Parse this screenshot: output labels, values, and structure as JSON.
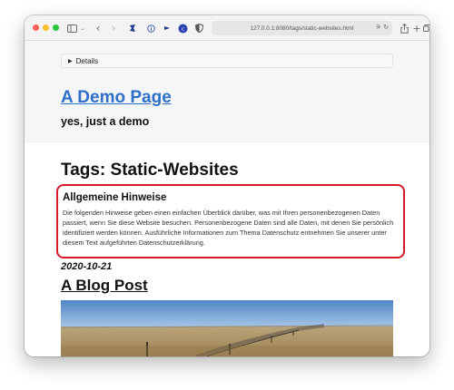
{
  "browser": {
    "url": "127.0.0.1:8080/tags/static-websites.html",
    "colors": {
      "close": "#ff5f57",
      "minimize": "#febc2e",
      "maximize": "#28c840"
    },
    "icons": [
      "sidebar-icon",
      "chevron-down-icon",
      "back-icon",
      "forward-icon",
      "extension-icon",
      "info-icon",
      "arrow-icon",
      "extension-badge-icon",
      "shield-icon",
      "translate-icon",
      "reload-icon",
      "share-icon",
      "new-tab-icon",
      "tab-overview-icon"
    ]
  },
  "header": {
    "details_label": "Details",
    "site_title": "A Demo Page",
    "site_subtitle": "yes, just a demo"
  },
  "main": {
    "tag_heading": "Tags: Static-Websites",
    "notice": {
      "title": "Allgemeine Hinweise",
      "body": "Die folgenden Hinweise geben einen einfachen Überblick darüber, was mit Ihren personenbezogenen Daten passiert, wenn Sie diese Website besuchen. Personenbezogene Daten sind alle Daten, mit denen Sie persönlich identifiziert werden können. Ausführliche Informationen zum Thema Datenschutz entnehmen Sie unserer unter diesem Text aufgeführten Datenschutzerklärung."
    },
    "post": {
      "date": "2020-10-21",
      "title": "A Blog Post"
    },
    "accent_color": "#d7192a",
    "link_color": "#2f6fc7"
  }
}
